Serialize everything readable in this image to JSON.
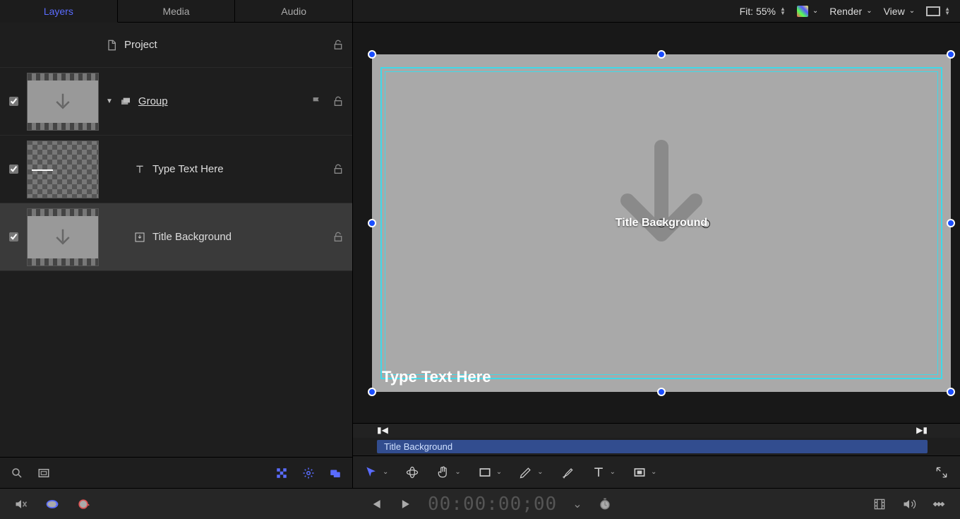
{
  "tabs": {
    "layers": "Layers",
    "media": "Media",
    "audio": "Audio"
  },
  "toolbar": {
    "fit_label": "Fit: 55%",
    "render_label": "Render",
    "view_label": "View"
  },
  "layers": {
    "project_label": "Project",
    "group_label": "Group",
    "text_label": "Type Text Here",
    "title_bg_label": "Title Background"
  },
  "canvas": {
    "center_label": "Title Background",
    "overlay_text": "Type Text Here",
    "mini_clip_label": "Title Background"
  },
  "transport": {
    "timecode": "00:00:00;00"
  }
}
